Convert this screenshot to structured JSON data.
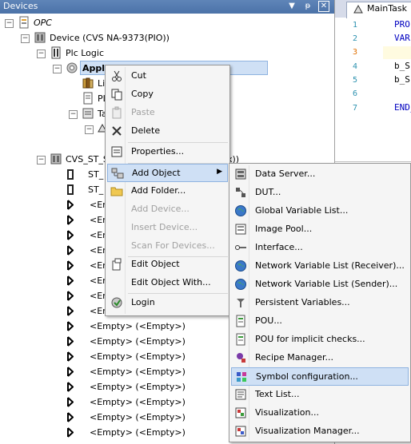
{
  "devices_pane": {
    "title": "Devices",
    "header_buttons": [
      "▼",
      "ᵽ",
      "✕"
    ]
  },
  "tree": {
    "root": "OPC",
    "device": "Device (CVS NA-9373(PIO))",
    "plc_logic": "Plc Logic",
    "application": "Appli",
    "lib_partial": "Lib",
    "plc_partial": "PL",
    "task_partial": "Ta",
    "cvs_partial": "CVS_ST_S",
    "cvs_tail": "x))",
    "st_rows": [
      "ST_",
      "ST_"
    ],
    "empty_partial": "<Em",
    "empty_full": "<Empty> (<Empty>)"
  },
  "code_pane": {
    "tab": "MainTask",
    "lines": [
      {
        "n": "1",
        "code": "PRO"
      },
      {
        "n": "2",
        "code": "VAR"
      },
      {
        "n": "3",
        "code": ""
      },
      {
        "n": "4",
        "code": "b_S"
      },
      {
        "n": "5",
        "code": "b_S"
      },
      {
        "n": "6",
        "code": ""
      },
      {
        "n": "7",
        "code": "END_"
      }
    ]
  },
  "context_menu": {
    "items": [
      {
        "label": "Cut",
        "disabled": false
      },
      {
        "label": "Copy",
        "disabled": false
      },
      {
        "label": "Paste",
        "disabled": true
      },
      {
        "label": "Delete",
        "disabled": false
      },
      {
        "label": "Properties...",
        "disabled": false
      },
      {
        "label": "Add Object",
        "disabled": false
      },
      {
        "label": "Add Folder...",
        "disabled": false
      },
      {
        "label": "Add Device...",
        "disabled": true
      },
      {
        "label": "Insert Device...",
        "disabled": true
      },
      {
        "label": "Scan For Devices...",
        "disabled": true
      },
      {
        "label": "Edit Object",
        "disabled": false
      },
      {
        "label": "Edit Object With...",
        "disabled": false
      },
      {
        "label": "Login",
        "disabled": false
      }
    ]
  },
  "submenu": {
    "items": [
      "Data Server...",
      "DUT...",
      "Global Variable List...",
      "Image Pool...",
      "Interface...",
      "Network Variable List (Receiver)...",
      "Network Variable List (Sender)...",
      "Persistent Variables...",
      "POU...",
      "POU for implicit checks...",
      "Recipe Manager...",
      "Symbol configuration...",
      "Text List...",
      "Visualization...",
      "Visualization Manager..."
    ],
    "highlighted": "Symbol configuration..."
  },
  "colors": {
    "header": "#4b72a8",
    "selection": "#cfe0f5",
    "code_keyword": "#0000c0"
  }
}
